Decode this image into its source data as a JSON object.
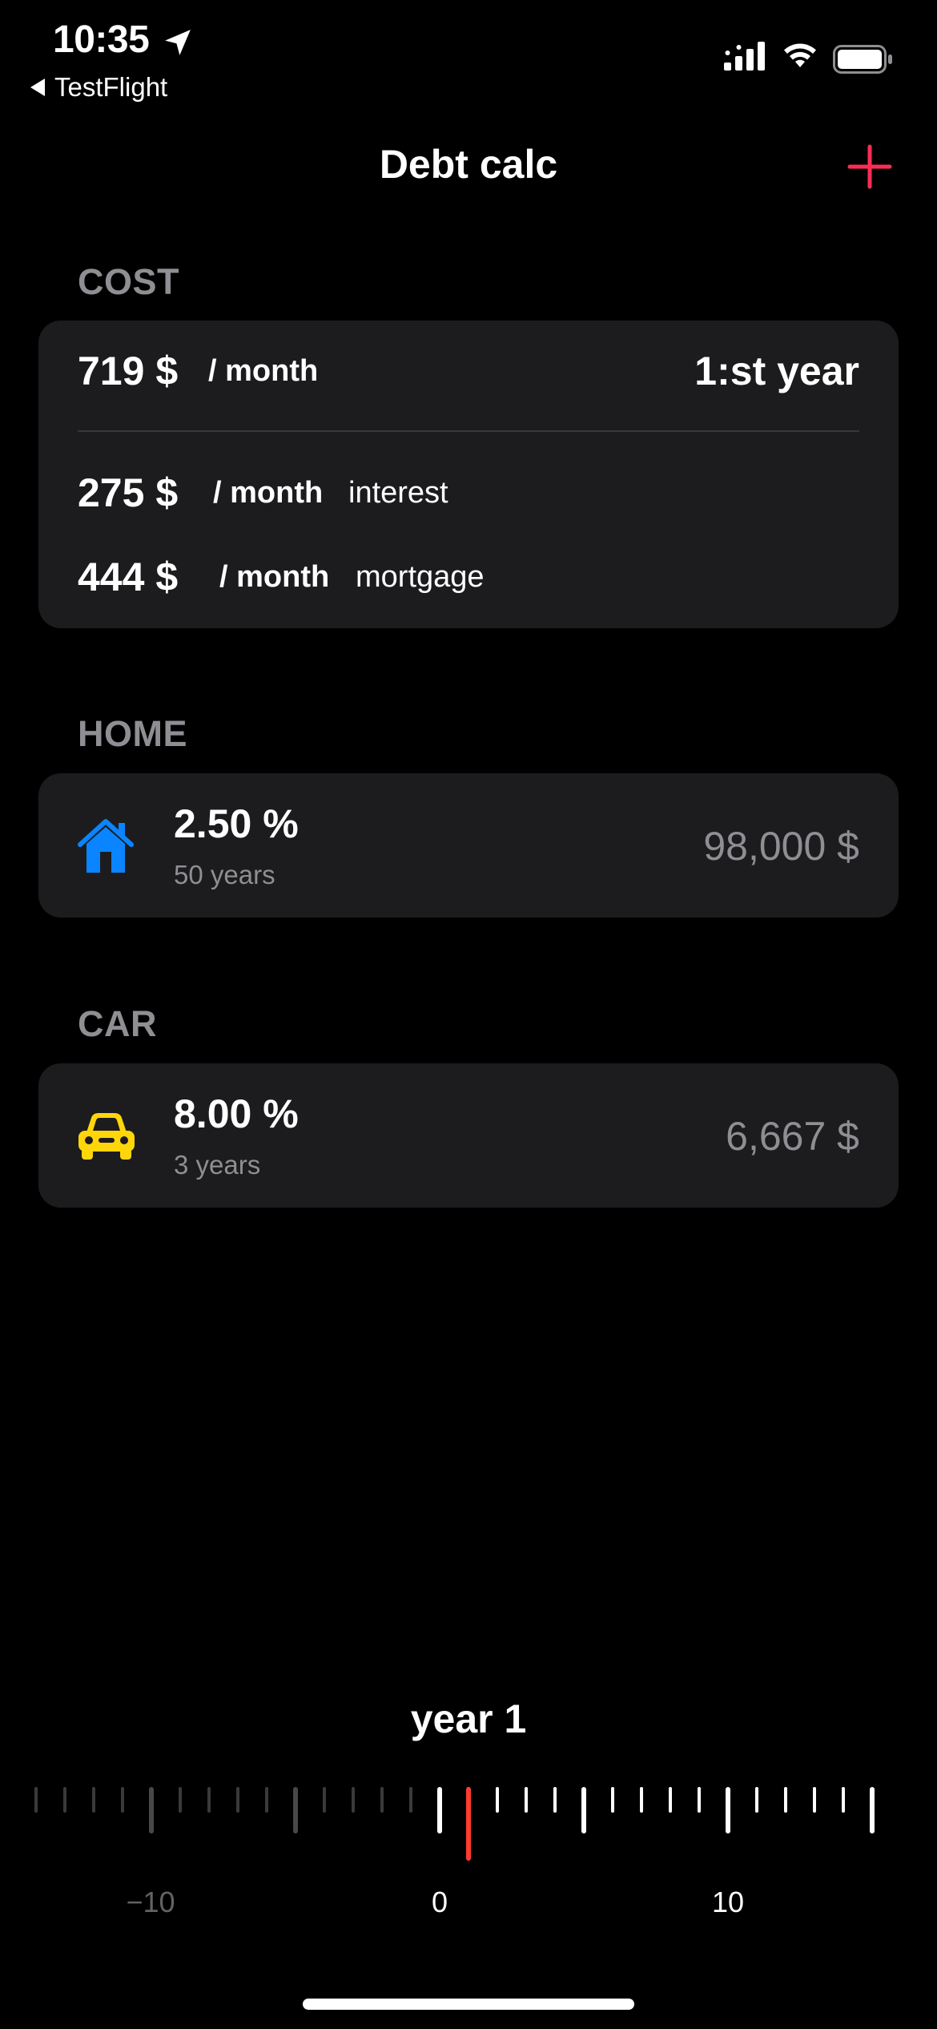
{
  "status_bar": {
    "time": "10:35",
    "back_label": "TestFlight"
  },
  "nav": {
    "title": "Debt calc"
  },
  "accent_color": "#ff2d55",
  "cost": {
    "header": "COST",
    "total_amount": "719 $",
    "total_per": "/ month",
    "year_label": "1:st year",
    "interest_amount": "275 $",
    "interest_per": "/ month",
    "interest_label": "interest",
    "mortgage_amount": "444 $",
    "mortgage_per": "/ month",
    "mortgage_label": "mortgage"
  },
  "home": {
    "header": "HOME",
    "icon": "house-icon",
    "icon_color": "#0a84ff",
    "rate": "2.50 %",
    "term": "50 years",
    "amount": "98,000 $"
  },
  "car": {
    "header": "CAR",
    "icon": "car-icon",
    "icon_color": "#ffd60a",
    "rate": "8.00 %",
    "term": "3 years",
    "amount": "6,667 $"
  },
  "year_selector": {
    "title": "year 1",
    "selected_year": 1,
    "labels": [
      "−10",
      "0",
      "10"
    ],
    "indicator_color": "#ff3b30"
  }
}
